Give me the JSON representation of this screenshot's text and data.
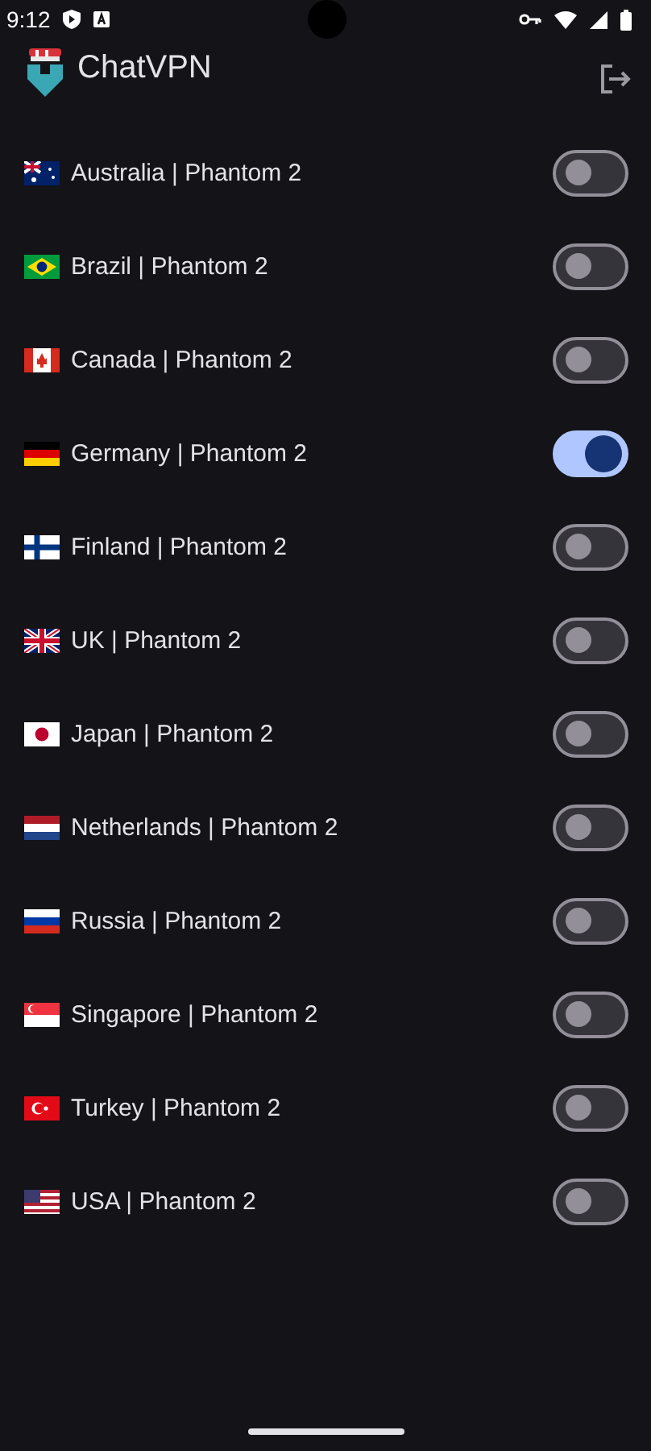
{
  "status_bar": {
    "time": "9:12"
  },
  "app_bar": {
    "title": "ChatVPN"
  },
  "servers": [
    {
      "kind": "au",
      "label": "Australia | Phantom 2",
      "on": false
    },
    {
      "kind": "br",
      "label": "Brazil | Phantom 2",
      "on": false
    },
    {
      "kind": "ca",
      "label": "Canada | Phantom 2",
      "on": false
    },
    {
      "kind": "de",
      "label": "Germany | Phantom 2",
      "on": true
    },
    {
      "kind": "fi",
      "label": "Finland | Phantom 2",
      "on": false
    },
    {
      "kind": "gb",
      "label": "UK | Phantom 2",
      "on": false
    },
    {
      "kind": "jp",
      "label": "Japan | Phantom 2",
      "on": false
    },
    {
      "kind": "nl",
      "label": "Netherlands | Phantom 2",
      "on": false
    },
    {
      "kind": "ru",
      "label": "Russia | Phantom 2",
      "on": false
    },
    {
      "kind": "sg",
      "label": "Singapore | Phantom 2",
      "on": false
    },
    {
      "kind": "tr",
      "label": "Turkey | Phantom 2",
      "on": false
    },
    {
      "kind": "us",
      "label": "USA | Phantom 2",
      "on": false
    }
  ]
}
